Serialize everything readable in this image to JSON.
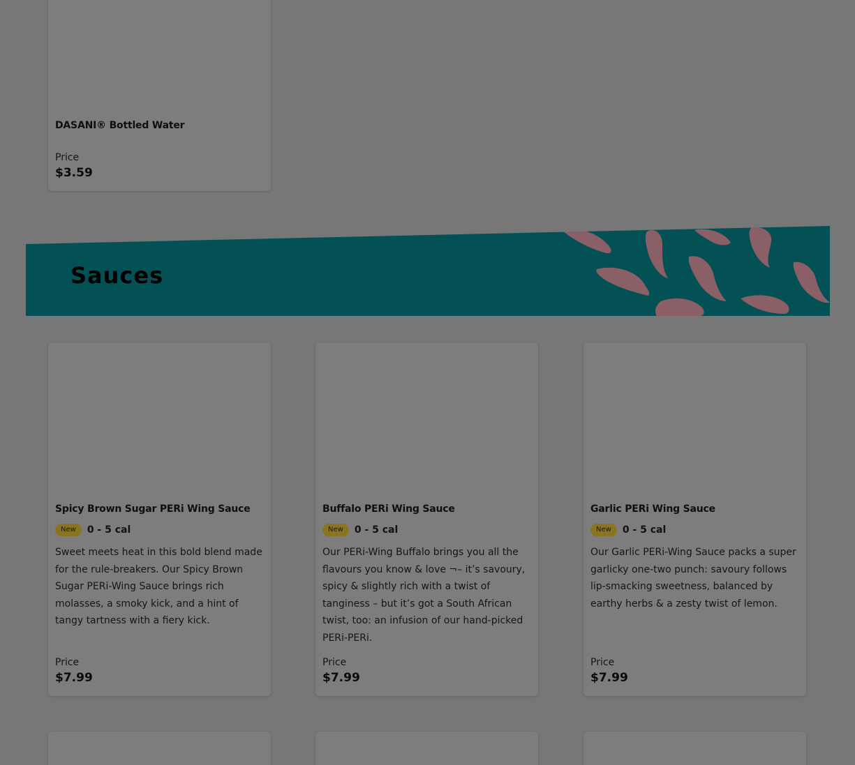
{
  "colors": {
    "page_bg": "#777777",
    "card_bg": "#7d7d7d",
    "banner_bg": "#035155",
    "chili": "#8b5f66",
    "badge_bg": "#8a7420"
  },
  "top_card": {
    "title": "DASANI® Bottled Water",
    "price_label": "Price",
    "price": "$3.59"
  },
  "sauces_banner": {
    "title": "Sauces",
    "decoration_icon": "chili-pepper-icon"
  },
  "sauce_items": [
    {
      "title": "Spicy Brown Sugar PERi Wing Sauce",
      "badge": "New",
      "calories": "0 - 5 cal",
      "description": "Sweet meets heat in this bold blend made for the rule-breakers. Our Spicy Brown Sugar PERi-Wing Sauce brings rich molasses, a smoky kick, and a hint of tangy tartness with a fiery kick.",
      "price_label": "Price",
      "price": "$7.99"
    },
    {
      "title": "Buffalo PERi Wing Sauce",
      "badge": "New",
      "calories": "0 - 5 cal",
      "description": "Our PERi-Wing Buffalo brings you all the flavours you know & love ¬– it’s savoury, spicy & slightly rich with a twist of tanginess – but it’s got a South African twist, too: an infusion of our hand-picked PERi-PERi.",
      "price_label": "Price",
      "price": "$7.99"
    },
    {
      "title": "Garlic PERi Wing Sauce",
      "badge": "New",
      "calories": "0 - 5 cal",
      "description": "Our Garlic PERi-Wing Sauce packs a super garlicky one-two punch: savoury follows lip-smacking sweetness, balanced by earthy herbs & a zesty twist of lemon.",
      "price_label": "Price",
      "price": "$7.99"
    }
  ]
}
